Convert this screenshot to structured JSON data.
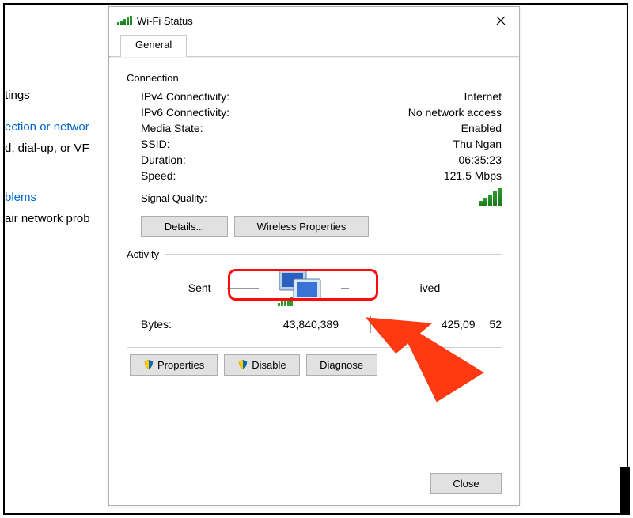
{
  "bg": {
    "settings": "tings",
    "connection_link": "ection or networ",
    "dial": "d, dial-up, or VF",
    "problems_link": "blems",
    "repair": "air network prob"
  },
  "dialog": {
    "title": "Wi-Fi Status",
    "tab_general": "General",
    "connection_group": "Connection",
    "ipv4_label": "IPv4 Connectivity:",
    "ipv4_value": "Internet",
    "ipv6_label": "IPv6 Connectivity:",
    "ipv6_value": "No network access",
    "media_label": "Media State:",
    "media_value": "Enabled",
    "ssid_label": "SSID:",
    "ssid_value": "Thu Ngan",
    "duration_label": "Duration:",
    "duration_value": "06:35:23",
    "speed_label": "Speed:",
    "speed_value": "121.5 Mbps",
    "signal_label": "Signal Quality:",
    "details_btn": "Details...",
    "wireless_btn": "Wireless Properties",
    "activity_group": "Activity",
    "sent": "Sent",
    "received": "ived",
    "bytes_label": "Bytes:",
    "bytes_sent": "43,840,389",
    "bytes_recv_partial": "425,09",
    "bytes_recv_tail": "52",
    "properties_btn": "Properties",
    "disable_btn": "Disable",
    "diagnose_btn": "Diagnose",
    "close_btn": "Close"
  }
}
